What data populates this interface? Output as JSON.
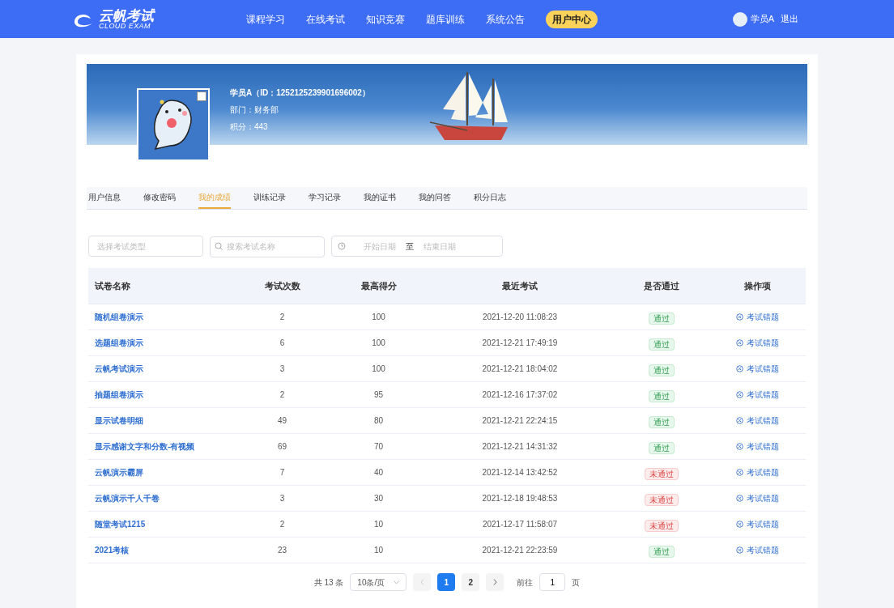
{
  "nav": {
    "logo_title": "云帆考试",
    "logo_subtitle": "CLOUD EXAM",
    "items": [
      {
        "label": "课程学习",
        "selected": false
      },
      {
        "label": "在线考试",
        "selected": false
      },
      {
        "label": "知识竞赛",
        "selected": false
      },
      {
        "label": "题库训练",
        "selected": false
      },
      {
        "label": "系统公告",
        "selected": false
      },
      {
        "label": "用户中心",
        "selected": true
      }
    ],
    "user": "学员A",
    "logout": "退出"
  },
  "profile": {
    "name_line": "学员A（ID：1252125239901696002）",
    "department": "部门：财务部",
    "points": "积分：443"
  },
  "tabs": [
    {
      "label": "用户信息",
      "selected": false
    },
    {
      "label": "修改密码",
      "selected": false
    },
    {
      "label": "我的成绩",
      "selected": true
    },
    {
      "label": "训练记录",
      "selected": false
    },
    {
      "label": "学习记录",
      "selected": false
    },
    {
      "label": "我的证书",
      "selected": false
    },
    {
      "label": "我的问答",
      "selected": false
    },
    {
      "label": "积分日志",
      "selected": false
    }
  ],
  "filters": {
    "type_placeholder": "选择考试类型",
    "search_placeholder": "搜索考试名称",
    "start_placeholder": "开始日期",
    "range_separator": "至",
    "end_placeholder": "结束日期"
  },
  "table": {
    "columns": [
      "试卷名称",
      "考试次数",
      "最高得分",
      "最近考试",
      "是否通过",
      "操作项"
    ],
    "rows": [
      {
        "name": "随机组卷演示",
        "count": "2",
        "score": "100",
        "last": "2021-12-20 11:08:23",
        "status": "通过",
        "passed": true,
        "action": "考试错题"
      },
      {
        "name": "选题组卷演示",
        "count": "6",
        "score": "100",
        "last": "2021-12-21 17:49:19",
        "status": "通过",
        "passed": true,
        "action": "考试错题"
      },
      {
        "name": "云帆考试演示",
        "count": "3",
        "score": "100",
        "last": "2021-12-21 18:04:02",
        "status": "通过",
        "passed": true,
        "action": "考试错题"
      },
      {
        "name": "抽题组卷演示",
        "count": "2",
        "score": "95",
        "last": "2021-12-16 17:37:02",
        "status": "通过",
        "passed": true,
        "action": "考试错题"
      },
      {
        "name": "显示试卷明细",
        "count": "49",
        "score": "80",
        "last": "2021-12-21 22:24:15",
        "status": "通过",
        "passed": true,
        "action": "考试错题"
      },
      {
        "name": "显示感谢文字和分数-有视频",
        "count": "69",
        "score": "70",
        "last": "2021-12-21 14:31:32",
        "status": "通过",
        "passed": true,
        "action": "考试错题"
      },
      {
        "name": "云帆演示霸屏",
        "count": "7",
        "score": "40",
        "last": "2021-12-14 13:42:52",
        "status": "未通过",
        "passed": false,
        "action": "考试错题"
      },
      {
        "name": "云帆演示千人千卷",
        "count": "3",
        "score": "30",
        "last": "2021-12-18 19:48:53",
        "status": "未通过",
        "passed": false,
        "action": "考试错题"
      },
      {
        "name": "随堂考试1215",
        "count": "2",
        "score": "10",
        "last": "2021-12-17 11:58:07",
        "status": "未通过",
        "passed": false,
        "action": "考试错题"
      },
      {
        "name": "2021考核",
        "count": "23",
        "score": "10",
        "last": "2021-12-21 22:23:59",
        "status": "通过",
        "passed": true,
        "action": "考试错题"
      }
    ]
  },
  "pagination": {
    "total": "共 13 条",
    "page_size": "10条/页",
    "pages": [
      {
        "label": "1",
        "selected": true
      },
      {
        "label": "2",
        "selected": false
      }
    ],
    "goto_label": "前往",
    "goto_value": "1",
    "page_unit": "页"
  }
}
